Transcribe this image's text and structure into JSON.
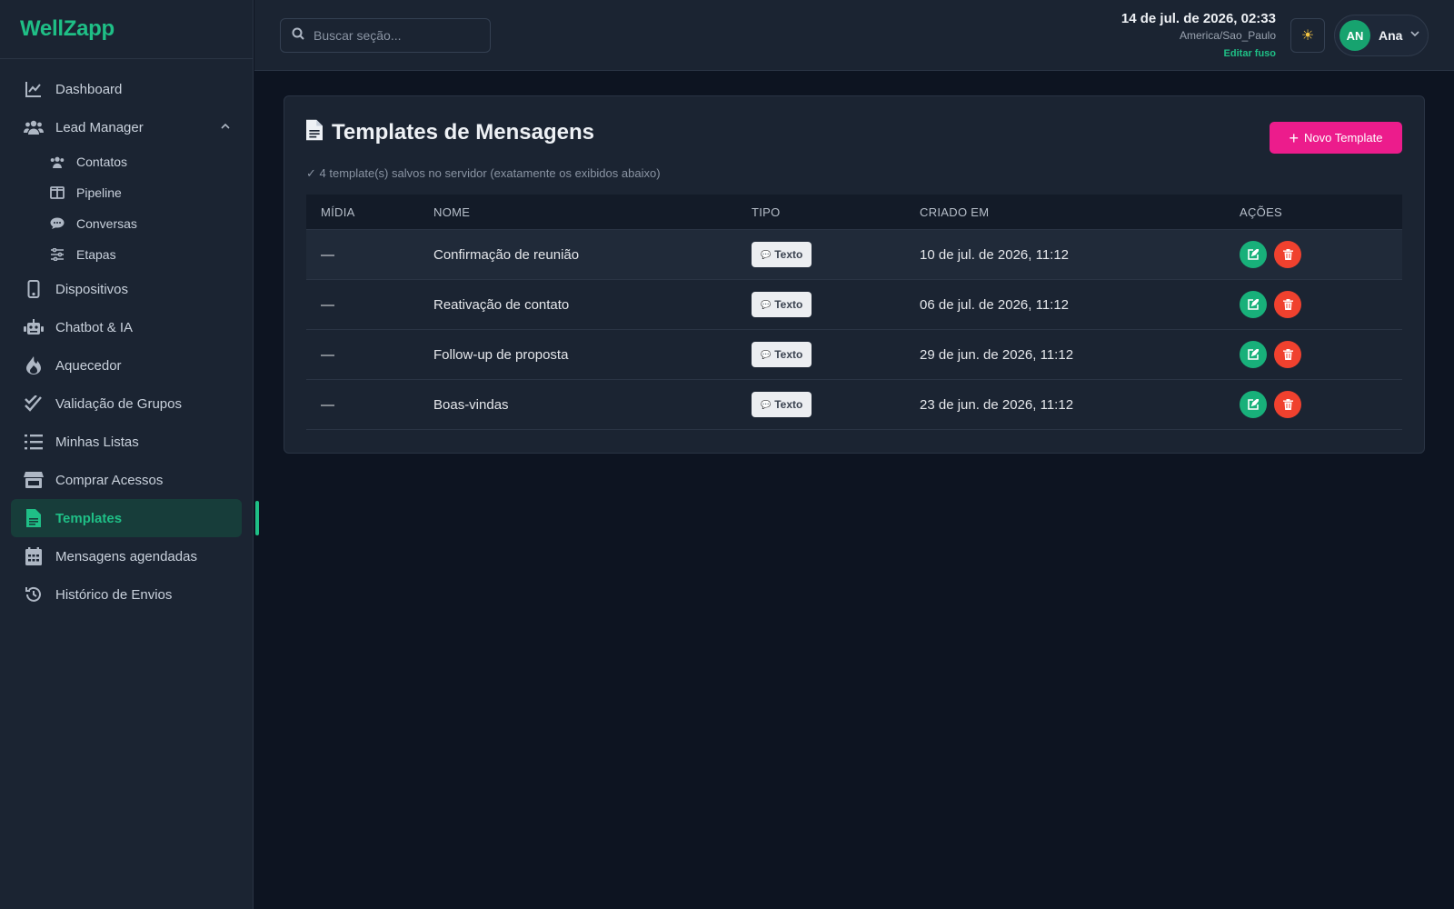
{
  "brand": "WellZapp",
  "sidebar": {
    "items": [
      {
        "label": "Dashboard",
        "icon": "chart-line-icon"
      },
      {
        "label": "Lead Manager",
        "icon": "users-icon",
        "expanded": true,
        "children": [
          {
            "label": "Contatos",
            "icon": "contacts-icon"
          },
          {
            "label": "Pipeline",
            "icon": "columns-icon"
          },
          {
            "label": "Conversas",
            "icon": "chat-icon"
          },
          {
            "label": "Etapas",
            "icon": "sliders-icon"
          }
        ]
      },
      {
        "label": "Dispositivos",
        "icon": "mobile-icon"
      },
      {
        "label": "Chatbot & IA",
        "icon": "robot-icon"
      },
      {
        "label": "Aquecedor",
        "icon": "fire-icon"
      },
      {
        "label": "Validação de Grupos",
        "icon": "double-check-icon"
      },
      {
        "label": "Minhas Listas",
        "icon": "list-icon"
      },
      {
        "label": "Comprar Acessos",
        "icon": "store-icon"
      },
      {
        "label": "Templates",
        "icon": "file-icon",
        "active": true
      },
      {
        "label": "Mensagens agendadas",
        "icon": "calendar-icon"
      },
      {
        "label": "Histórico de Envios",
        "icon": "history-icon"
      }
    ]
  },
  "topbar": {
    "search_placeholder": "Buscar seção...",
    "datetime": "14 de jul. de 2026, 02:33",
    "timezone": "America/Sao_Paulo",
    "edit_timezone": "Editar fuso",
    "theme_icon": "sun-icon",
    "user": {
      "initials": "AN",
      "name": "Ana"
    }
  },
  "main": {
    "title": "Templates de Mensagens",
    "new_button": "Novo Template",
    "saved_note": "✓ 4 template(s) salvos no servidor (exatamente os exibidos abaixo)",
    "table": {
      "headers": [
        "MÍDIA",
        "NOME",
        "TIPO",
        "CRIADO EM",
        "AÇÕES"
      ],
      "rows": [
        {
          "media": "—",
          "name": "Confirmação de reunião",
          "type": "Texto",
          "created": "10 de jul. de 2026, 11:12"
        },
        {
          "media": "—",
          "name": "Reativação de contato",
          "type": "Texto",
          "created": "06 de jul. de 2026, 11:12"
        },
        {
          "media": "—",
          "name": "Follow-up de proposta",
          "type": "Texto",
          "created": "29 de jun. de 2026, 11:12"
        },
        {
          "media": "—",
          "name": "Boas-vindas",
          "type": "Texto",
          "created": "23 de jun. de 2026, 11:12"
        }
      ]
    }
  },
  "colors": {
    "accent": "#1fbf86",
    "primary_button": "#ec1c8c",
    "edit_action": "#18b07a",
    "delete_action": "#f0412e",
    "background": "#0d1421",
    "surface": "#1b2432"
  }
}
